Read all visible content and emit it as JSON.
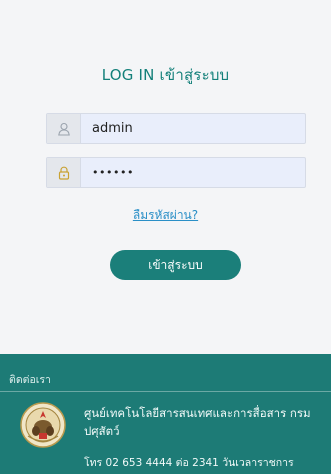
{
  "login": {
    "title": "LOG IN เข้าสู่ระบบ",
    "username_value": "admin",
    "password_value": "••••••",
    "forgot_link": "ลืมรหัสผ่าน?",
    "submit_label": "เข้าสู่ระบบ"
  },
  "icons": {
    "username": "user-icon",
    "password": "lock-icon"
  },
  "footer": {
    "contact_label": "ติดต่อเรา",
    "org_name": "ศูนย์เทคโนโลยีสารสนเทศและการสื่อสาร กรมปศุสัตว์",
    "phone": "โทร 02 653 4444 ต่อ 2341 วันเวลาราชการ"
  },
  "colors": {
    "accent": "#1b7f7a",
    "link": "#2a8fc7",
    "input_bg": "#e9eefb",
    "page_bg": "#f4f5f7"
  }
}
